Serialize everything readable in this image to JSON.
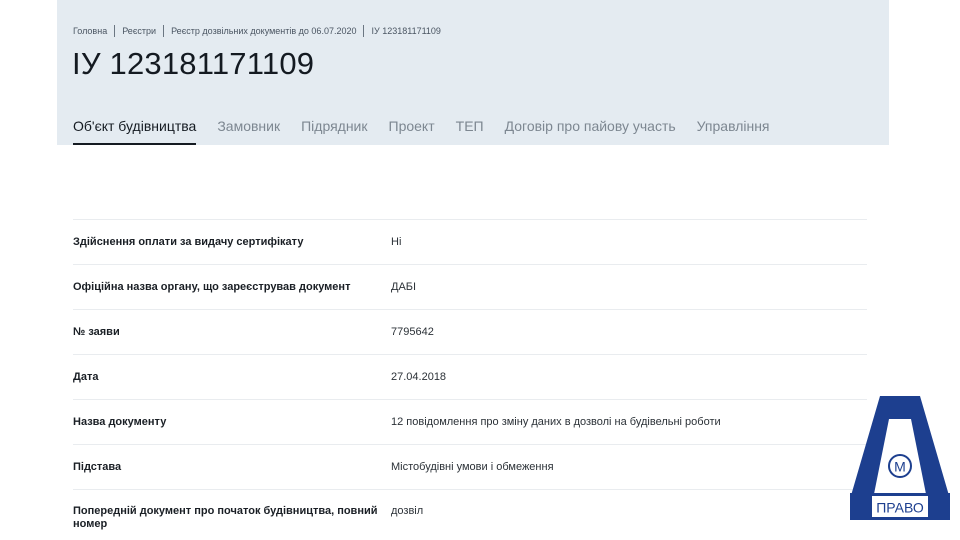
{
  "breadcrumb": {
    "items": [
      "Головна",
      "Реєстри",
      "Реєстр дозвільних документів до 06.07.2020",
      "ІУ 123181171109"
    ]
  },
  "page": {
    "title": "ІУ 123181171109"
  },
  "tabs": [
    {
      "label": "Об'єкт будівництва",
      "active": true
    },
    {
      "label": "Замовник",
      "active": false
    },
    {
      "label": "Підрядник",
      "active": false
    },
    {
      "label": "Проект",
      "active": false
    },
    {
      "label": "ТЕП",
      "active": false
    },
    {
      "label": "Договір про пайову участь",
      "active": false
    },
    {
      "label": "Управління",
      "active": false
    }
  ],
  "details": [
    {
      "label": "Здійснення оплати за видачу сертифікату",
      "value": "Ні"
    },
    {
      "label": "Офіційна назва органу, що зареєстрував документ",
      "value": "ДАБІ"
    },
    {
      "label": "№ заяви",
      "value": "7795642"
    },
    {
      "label": "Дата",
      "value": "27.04.2018"
    },
    {
      "label": "Назва документу",
      "value": "12 повідомлення про зміну даних в дозволі на будівельні роботи"
    },
    {
      "label": "Підстава",
      "value": "Містобудівні умови і обмеження"
    },
    {
      "label": "Попередній документ про початок будівництва, повний номер",
      "value": "дозвіл"
    }
  ],
  "logo": {
    "mark": "М",
    "text": "ПРАВО",
    "color": "#1d3f8f"
  },
  "colors": {
    "header_bg": "#e4ebf1",
    "text_primary": "#141a21",
    "tab_inactive": "#7d8791",
    "divider": "#e9ecef"
  }
}
